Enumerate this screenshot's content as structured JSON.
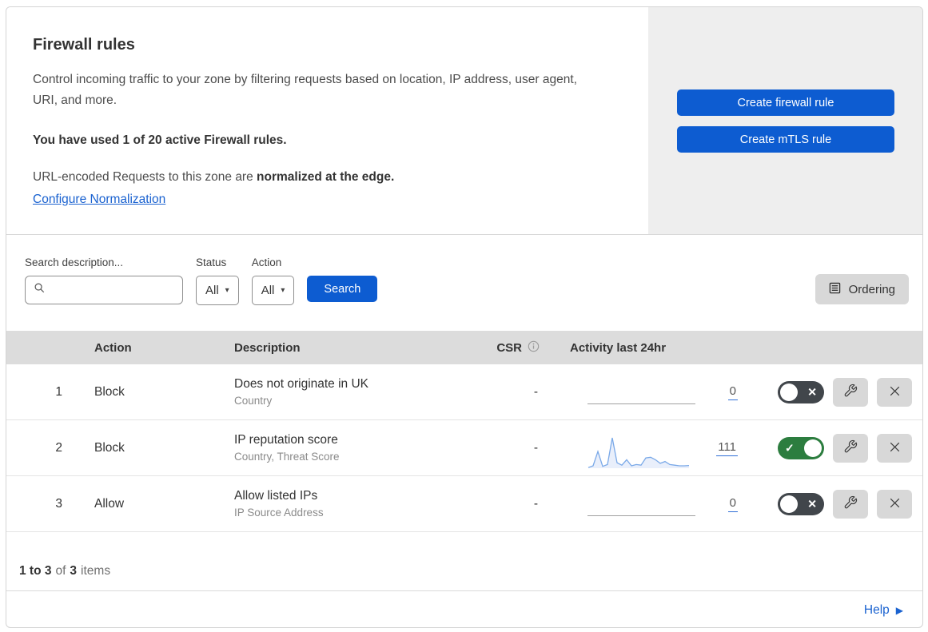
{
  "colors": {
    "primary_blue": "#0d5cd1",
    "link_blue": "#1a62d0",
    "toggle_on_green": "#2c7d3f",
    "toggle_off_gray": "#41464b",
    "table_header_bg": "#dcdcdc",
    "side_panel_bg": "#eeeeee",
    "icon_button_bg": "#d8d8d8",
    "border": "#d4d4d4",
    "sparkline_line": "#7aa9e8",
    "sparkline_fill": "#e9effb",
    "flatline_gray": "#a0a0a0"
  },
  "header": {
    "title": "Firewall rules",
    "description": "Control incoming traffic to your zone by filtering requests based on location, IP address, user agent, URI, and more.",
    "usage_text": "You have used 1 of 20 active Firewall rules.",
    "normalization_text": "URL-encoded Requests to this zone are ",
    "normalization_bold": "normalized at the edge.",
    "normalization_link": "Configure Normalization",
    "create_firewall_button": "Create firewall rule",
    "create_mtls_button": "Create mTLS rule"
  },
  "filters": {
    "search_label": "Search description...",
    "status_label": "Status",
    "status_value": "All",
    "action_label": "Action",
    "action_value": "All",
    "search_button": "Search",
    "ordering_button": "Ordering"
  },
  "table": {
    "headers": {
      "action": "Action",
      "description": "Description",
      "csr": "CSR",
      "activity": "Activity last 24hr"
    },
    "rows": [
      {
        "priority": "1",
        "action": "Block",
        "description": "Does not originate in UK",
        "fields": "Country",
        "csr": "-",
        "activity_count": "0",
        "enabled": false
      },
      {
        "priority": "2",
        "action": "Block",
        "description": "IP reputation score",
        "fields": "Country, Threat Score",
        "csr": "-",
        "activity_count": "111",
        "enabled": true,
        "sparkline": [
          2,
          8,
          55,
          6,
          12,
          100,
          18,
          10,
          28,
          8,
          12,
          10,
          34,
          36,
          28,
          16,
          22,
          12,
          10,
          8,
          8,
          9
        ]
      },
      {
        "priority": "3",
        "action": "Allow",
        "description": "Allow listed IPs",
        "fields": "IP Source Address",
        "csr": "-",
        "activity_count": "0",
        "enabled": false
      }
    ]
  },
  "footer": {
    "range_label": "1 to 3",
    "of_text": "of",
    "total_label": "3",
    "items_text": "items",
    "help_link": "Help"
  }
}
